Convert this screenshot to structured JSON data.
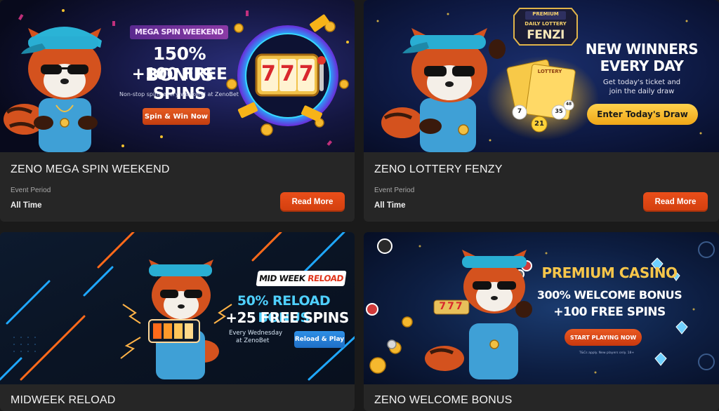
{
  "cards": [
    {
      "title": "ZENO MEGA SPIN WEEKEND",
      "period_label": "Event Period",
      "period_value": "All Time",
      "read_more": "Read More",
      "banner": {
        "ribbon": "MEGA SPIN WEEKEND",
        "headline_1": "150% BONUS",
        "headline_2": "+100 FREE SPINS",
        "subtext": "Non-stop spins every weekend at ZenoBet",
        "cta": "Spin & Win Now",
        "slot_digits": "777"
      }
    },
    {
      "title": "ZENO LOTTERY FENZY",
      "period_label": "Event Period",
      "period_value": "All Time",
      "read_more": "Read More",
      "banner": {
        "badge_top": "PREMIUM",
        "badge_mid": "DAILY LOTTERY",
        "badge_main": "FENZI",
        "headline_1": "NEW WINNERS",
        "headline_2": "EVERY DAY",
        "subtext_1": "Get today's ticket and",
        "subtext_2": "join the daily draw",
        "cta": "Enter Today's Draw",
        "ticket_label": "LOTTERY",
        "balls": [
          "7",
          "21",
          "35",
          "48"
        ]
      }
    },
    {
      "title": "MIDWEEK RELOAD",
      "banner": {
        "tag": "MID WEEK RELOAD",
        "tag_accent": "RELOAD",
        "headline_1": "50% RELOAD BONUS",
        "headline_2": "+25 FREE SPINS",
        "subtext_1": "Every Wednesday",
        "subtext_2": "at ZenoBet",
        "cta": "Reload & Play"
      }
    },
    {
      "title": "ZENO WELCOME BONUS",
      "banner": {
        "headline_1": "PREMIUM CASINO",
        "headline_2": "300% WELCOME BONUS",
        "headline_3": "+100 FREE SPINS",
        "cta": "START PLAYING NOW",
        "fineprint": "T&Cs apply. New players only. 18+",
        "slot_digits": "777"
      }
    }
  ],
  "colors": {
    "page_bg": "#1a1a1a",
    "card_bg": "#262626",
    "button_orange": "#e0481a",
    "gold": "#f5b82e",
    "cyan": "#3fc3e0"
  },
  "icons": {
    "mascot": "red-panda-mascot-icon",
    "slot_machine": "slot-machine-icon",
    "lottery_ticket": "lottery-ticket-icon",
    "battery": "battery-icon",
    "coin": "coin-icon",
    "gem": "gem-icon"
  }
}
